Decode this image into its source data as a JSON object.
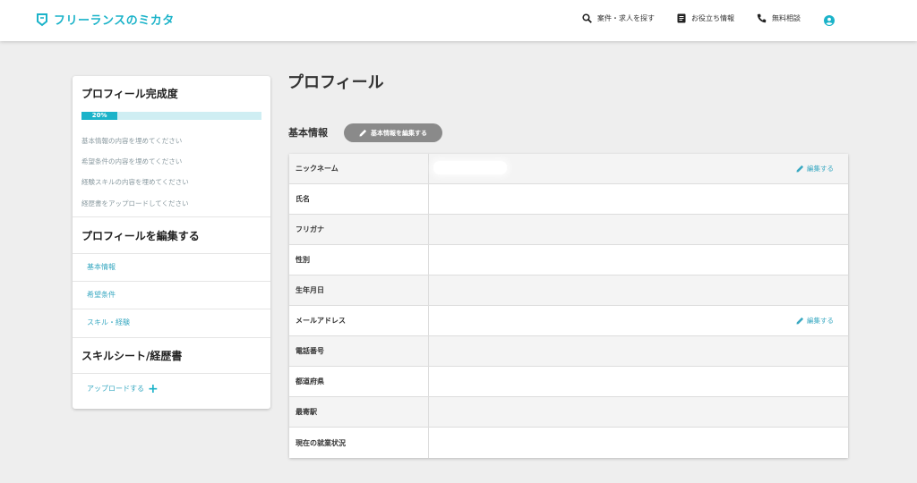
{
  "header": {
    "logo_text": "フリーランスのミカタ",
    "nav": [
      {
        "label": "案件・求人を探す",
        "icon": "search-icon"
      },
      {
        "label": "お役立ち情報",
        "icon": "document-icon"
      },
      {
        "label": "無料相談",
        "icon": "phone-icon"
      }
    ],
    "user_icon": "user-icon"
  },
  "sidebar": {
    "completion_title": "プロフィール完成度",
    "progress": {
      "percent": 20,
      "label": "20%"
    },
    "todo_links": [
      "基本情報の内容を埋めてください",
      "希望条件の内容を埋めてください",
      "経験スキルの内容を埋めてください",
      "経歴書をアップロードしてください"
    ],
    "edit_title": "プロフィールを編集する",
    "edit_items": [
      "基本情報",
      "希望条件",
      "スキル・経験"
    ],
    "skillsheet_title": "スキルシート/経歴書",
    "upload_label": "アップロードする"
  },
  "main": {
    "page_title": "プロフィール",
    "section_title": "基本情報",
    "edit_basic_button": "基本情報を編集する",
    "rows": [
      {
        "label": "ニックネーム",
        "edit": "編集する"
      },
      {
        "label": "氏名"
      },
      {
        "label": "フリガナ"
      },
      {
        "label": "性別"
      },
      {
        "label": "生年月日"
      },
      {
        "label": "メールアドレス",
        "edit": "編集する"
      },
      {
        "label": "電話番号"
      },
      {
        "label": "都道府県"
      },
      {
        "label": "最寄駅"
      },
      {
        "label": "現在の就業状況"
      }
    ]
  },
  "colors": {
    "accent": "#1bb3c9",
    "link": "#3aa9c2",
    "button_gray": "#8a8a8a",
    "background": "#eeeeee"
  }
}
